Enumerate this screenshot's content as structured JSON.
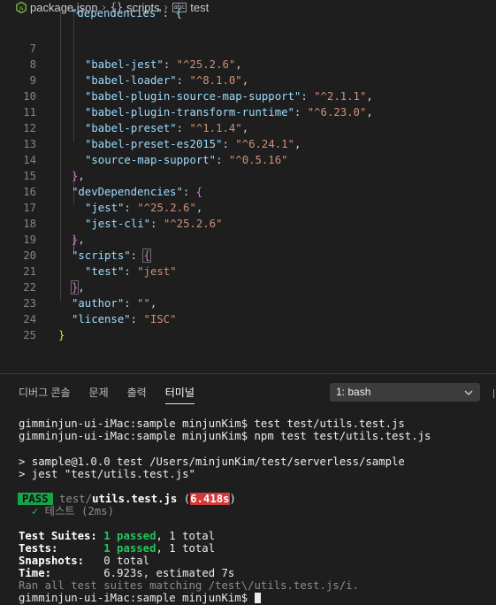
{
  "breadcrumb": {
    "file": "package.json",
    "section": "scripts",
    "key": "test",
    "section_prefix": "{}",
    "key_prefix": "abc"
  },
  "editor": {
    "lines": [
      {
        "n": "7",
        "text": "\"babel-jest\": \"^25.2.6\","
      },
      {
        "n": "8",
        "text": "\"babel-loader\": \"^8.1.0\","
      }
    ],
    "partial_line": "\"dependencies\": {",
    "l7": {
      "n": "7",
      "key": "\"babel-jest\"",
      "val": "\"^25.2.6\""
    },
    "l8": {
      "n": "8",
      "key": "\"babel-loader\"",
      "val": "\"^8.1.0\""
    },
    "l9": {
      "n": "9",
      "key": "\"babel-plugin-source-map-support\"",
      "val": "\"^2.1.1\""
    },
    "l10": {
      "n": "10",
      "key": "\"babel-plugin-transform-runtime\"",
      "val": "\"^6.23.0\""
    },
    "l11": {
      "n": "11",
      "key": "\"babel-preset\"",
      "val": "\"^1.1.4\""
    },
    "l12": {
      "n": "12",
      "key": "\"babel-preset-es2015\"",
      "val": "\"^6.24.1\""
    },
    "l13": {
      "n": "13",
      "key": "\"source-map-support\"",
      "val": "\"^0.5.16\""
    },
    "l14": {
      "n": "14"
    },
    "l15": {
      "n": "15",
      "key": "\"devDependencies\""
    },
    "l16": {
      "n": "16",
      "key": "\"jest\"",
      "val": "\"^25.2.6\""
    },
    "l17": {
      "n": "17",
      "key": "\"jest-cli\"",
      "val": "\"^25.2.6\""
    },
    "l18": {
      "n": "18"
    },
    "l19": {
      "n": "19",
      "key": "\"scripts\""
    },
    "l20": {
      "n": "20",
      "key": "\"test\"",
      "val": "\"jest\""
    },
    "l21": {
      "n": "21"
    },
    "l22": {
      "n": "22",
      "key": "\"author\"",
      "val": "\"\""
    },
    "l23": {
      "n": "23",
      "key": "\"license\"",
      "val": "\"ISC\""
    },
    "l24": {
      "n": "24"
    },
    "l25": {
      "n": "25"
    }
  },
  "panel": {
    "tabs": [
      "디버그 콘솔",
      "문제",
      "출력",
      "터미널"
    ],
    "terminal_select": "1: bash"
  },
  "terminal": {
    "cmd1": "gimminjun-ui-iMac:sample minjunKim$ test test/utils.test.js",
    "cmd2": "gimminjun-ui-iMac:sample minjunKim$ npm test test/utils.test.js",
    "npm1": "> sample@1.0.0 test /Users/minjunKim/test/serverless/sample",
    "npm2": "> jest \"test/utils.test.js\"",
    "pass_badge": "PASS",
    "pass_dir": "test/",
    "pass_file": "utils.test.js",
    "pass_open": " (",
    "pass_time": "6.418s",
    "pass_close": ")",
    "test_check": "✓",
    "test_name": "테스트 (2ms)",
    "suites_label": "Test Suites:",
    "suites_passed": "1 passed",
    "suites_total": ", 1 total",
    "tests_label": "Tests:",
    "tests_passed": "1 passed",
    "tests_total": ", 1 total",
    "snap_label": "Snapshots:",
    "snap_value": "0 total",
    "time_label": "Time:",
    "time_value": "6.923s, estimated 7s",
    "ran": "Ran all test suites matching /test\\/utils.test.js/i.",
    "prompt": "gimminjun-ui-iMac:sample minjunKim$ "
  },
  "colors": {
    "pass_bg": "#17a34a",
    "slow_bg": "#d03a3a",
    "json_key": "#9cdcfe",
    "json_string": "#ce9178"
  }
}
